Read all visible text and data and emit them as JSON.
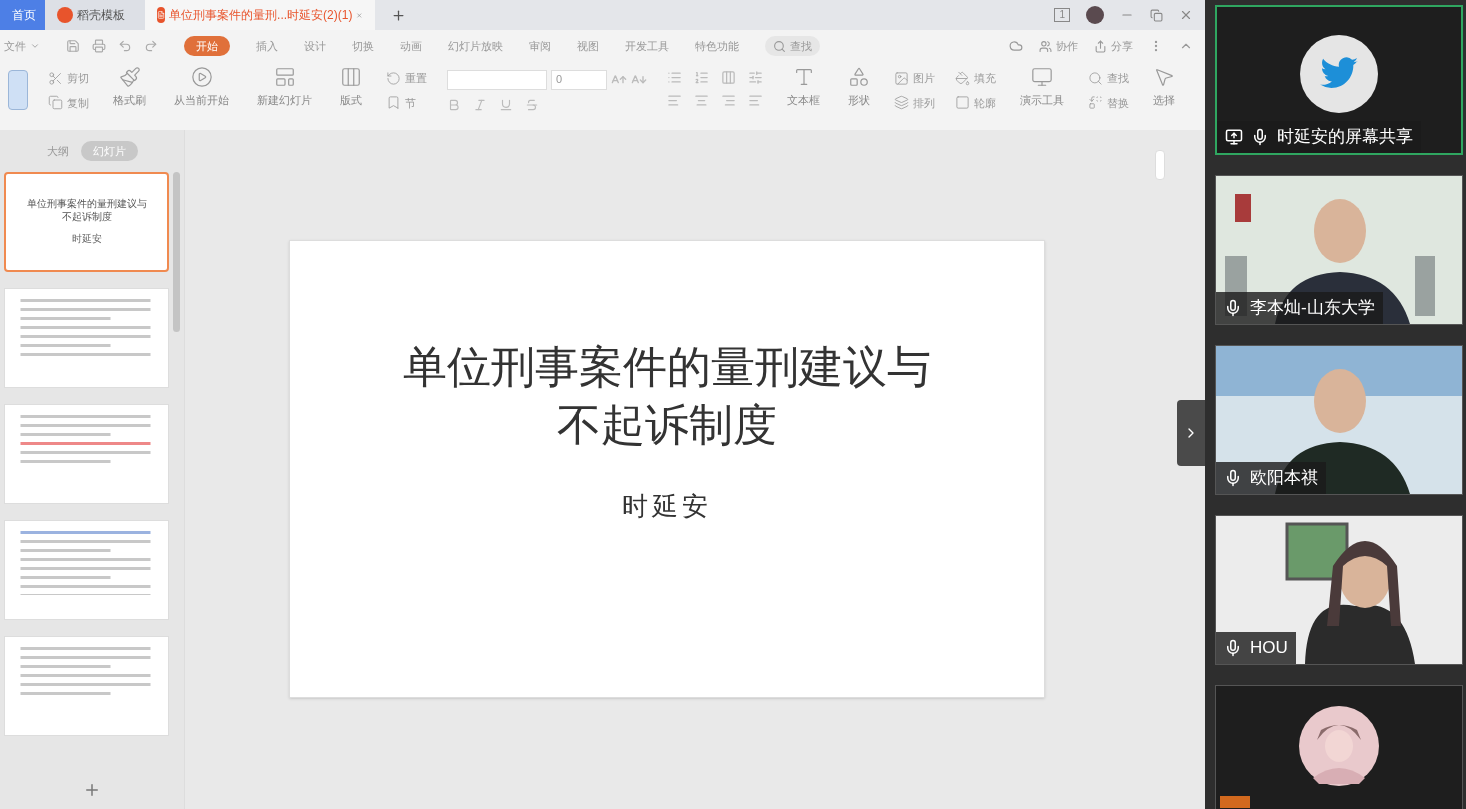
{
  "window_tabs": [
    {
      "label": "首页",
      "selected": false,
      "kind": "home"
    },
    {
      "label": "稻壳模板",
      "selected": false,
      "kind": "store"
    },
    {
      "label": "单位刑事案件的量刑...时延安(2)(1)",
      "selected": true,
      "kind": "doc"
    }
  ],
  "window_count": "1",
  "file_menu": "文件",
  "ribbon_tabs": [
    {
      "label": "开始",
      "selected": true
    },
    {
      "label": "插入",
      "selected": false
    },
    {
      "label": "设计",
      "selected": false
    },
    {
      "label": "切换",
      "selected": false
    },
    {
      "label": "动画",
      "selected": false
    },
    {
      "label": "幻灯片放映",
      "selected": false
    },
    {
      "label": "审阅",
      "selected": false
    },
    {
      "label": "视图",
      "selected": false
    },
    {
      "label": "开发工具",
      "selected": false
    },
    {
      "label": "特色功能",
      "selected": false
    }
  ],
  "search_label": "查找",
  "ribbon_actions": [
    "协作",
    "分享"
  ],
  "toolbar": [
    {
      "kind": "stack",
      "items": [
        "剪切",
        "复制"
      ]
    },
    {
      "kind": "big",
      "label": "格式刷"
    },
    {
      "kind": "big",
      "label": "从当前开始"
    },
    {
      "kind": "big",
      "label": "新建幻灯片"
    },
    {
      "kind": "big",
      "label": "版式"
    },
    {
      "kind": "stack",
      "items": [
        "重置",
        "节"
      ]
    },
    {
      "kind": "font",
      "size": "0"
    },
    {
      "kind": "paragraph"
    },
    {
      "kind": "big",
      "label": "文本框"
    },
    {
      "kind": "big",
      "label": "形状"
    },
    {
      "kind": "stack",
      "items": [
        "图片",
        "排列"
      ]
    },
    {
      "kind": "stack",
      "items": [
        "填充",
        "轮廓"
      ]
    },
    {
      "kind": "big",
      "label": "演示工具"
    },
    {
      "kind": "stack",
      "items": [
        "查找",
        "替换"
      ]
    },
    {
      "kind": "big",
      "label": "选择"
    }
  ],
  "slide_panel": {
    "views": [
      {
        "label": "大纲",
        "selected": false
      },
      {
        "label": "幻灯片",
        "selected": true
      }
    ],
    "thumbnails": [
      {
        "kind": "title",
        "title": "单位刑事案件的量刑建议与不起诉制度",
        "author": "时延安",
        "selected": true
      },
      {
        "kind": "list",
        "selected": false
      },
      {
        "kind": "text",
        "selected": false
      },
      {
        "kind": "links",
        "selected": false
      },
      {
        "kind": "heading",
        "selected": false
      }
    ]
  },
  "slide": {
    "title_lines": [
      "单位刑事案件的量刑建议与",
      "不起诉制度"
    ],
    "author": "时延安"
  },
  "participants": [
    {
      "kind": "avatar",
      "name": "时延安的屏幕共享",
      "screen_share": true,
      "active": true
    },
    {
      "kind": "video",
      "name": "李本灿-山东大学",
      "screen_share": false,
      "active": false
    },
    {
      "kind": "video",
      "name": "欧阳本祺",
      "screen_share": false,
      "active": false
    },
    {
      "kind": "video",
      "name": "HOU",
      "screen_share": false,
      "active": false
    },
    {
      "kind": "photo_avatar",
      "active": false
    }
  ]
}
